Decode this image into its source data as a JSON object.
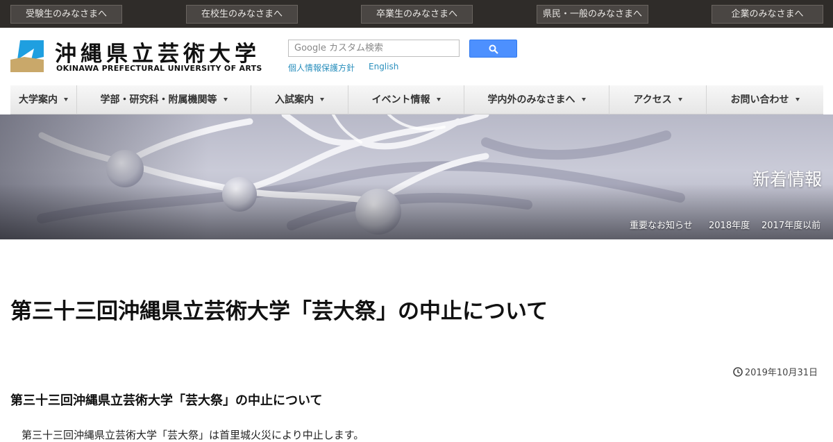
{
  "topbar": {
    "items": [
      "受験生のみなさまへ",
      "在校生のみなさまへ",
      "卒業生のみなさまへ",
      "県民・一般のみなさまへ",
      "企業のみなさまへ"
    ]
  },
  "header": {
    "logo_jp": "沖縄県立芸術大学",
    "logo_en": "OKINAWA PREFECTURAL UNIVERSITY OF ARTS",
    "logo_colors": {
      "blue": "#1f9fe0",
      "gold": "#c9a86a"
    },
    "search": {
      "placeholder": "Google カスタム検索",
      "button_icon": "search-icon",
      "button_color": "#4d90fe"
    },
    "links": [
      "個人情報保護方針",
      "English"
    ]
  },
  "nav": {
    "items": [
      "大学案内",
      "学部・研究科・附属機関等",
      "入試案内",
      "イベント情報",
      "学内外のみなさまへ",
      "アクセス",
      "お問い合わせ"
    ]
  },
  "banner": {
    "title": "新着情報",
    "links": [
      "重要なお知らせ",
      "2018年度",
      "2017年度以前"
    ]
  },
  "article": {
    "title": "第三十三回沖縄県立芸術大学「芸大祭」の中止について",
    "date": "2019年10月31日",
    "subheading": "第三十三回沖縄県立芸術大学「芸大祭」の中止について",
    "body": "第三十三回沖縄県立芸術大学「芸大祭」は首里城火災により中止します。"
  }
}
